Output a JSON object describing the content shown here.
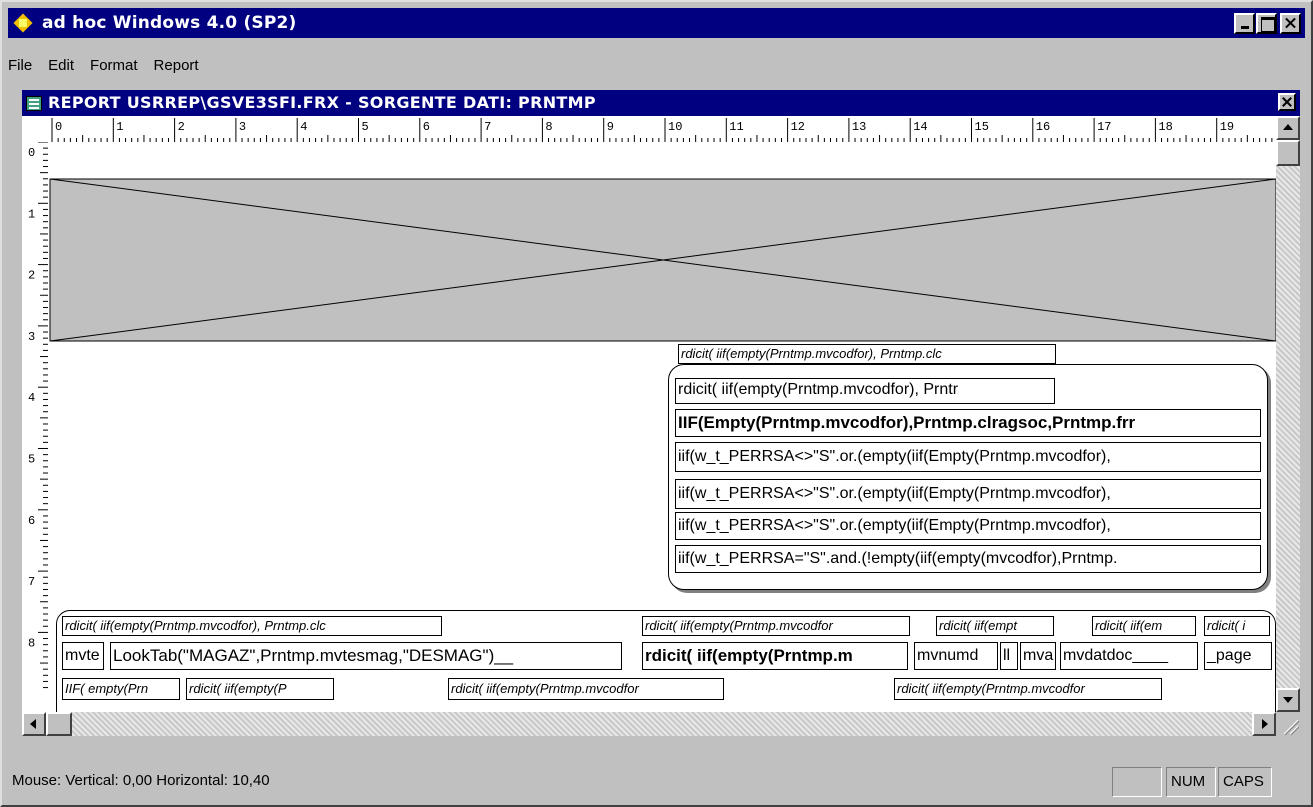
{
  "app": {
    "title": "ad hoc Windows 4.0 (SP2)"
  },
  "menu": [
    {
      "label": "File"
    },
    {
      "label": "Edit"
    },
    {
      "label": "Format"
    },
    {
      "label": "Report"
    }
  ],
  "child": {
    "title": "REPORT USRREP\\GSVE3SFI.FRX - SORGENTE DATI: PRNTMP"
  },
  "ruler": {
    "horizontal": [
      "0",
      "1",
      "2",
      "3",
      "4",
      "5",
      "6",
      "7",
      "8",
      "9",
      "10",
      "11",
      "12",
      "13",
      "14",
      "15",
      "16",
      "17",
      "18",
      "19"
    ],
    "vertical": [
      "0",
      "1",
      "2",
      "3",
      "4",
      "5",
      "6",
      "7",
      "8"
    ]
  },
  "fields": {
    "header_caption": "rdicit( iif(empty(Prntmp.mvcodfor), Prntmp.clc",
    "box1": "rdicit( iif(empty(Prntmp.mvcodfor), Prntr",
    "box2": "IIF(Empty(Prntmp.mvcodfor),Prntmp.clragsoc,Prntmp.frr",
    "box3": "iif(w_t_PERRSA<>\"S\".or.(empty(iif(Empty(Prntmp.mvcodfor),",
    "box4": "iif(w_t_PERRSA<>\"S\".or.(empty(iif(Empty(Prntmp.mvcodfor),",
    "box5": "iif(w_t_PERRSA<>\"S\".or.(empty(iif(Empty(Prntmp.mvcodfor),",
    "box6": "iif(w_t_PERRSA=\"S\".and.(!empty(iif(empty(mvcodfor),Prntmp.",
    "row1_a": "rdicit( iif(empty(Prntmp.mvcodfor), Prntmp.clc",
    "row1_b": "rdicit( iif(empty(Prntmp.mvcodfor",
    "row1_c": "rdicit( iif(empt",
    "row1_d": "rdicit( iif(em",
    "row1_e": "rdicit( i",
    "row2_a": "mvte",
    "row2_b": "LookTab(\"MAGAZ\",Prntmp.mvtesmag,\"DESMAG\")__",
    "row2_c": "rdicit( iif(empty(Prntmp.m",
    "row2_d": "mvnumd",
    "row2_e": "ll",
    "row2_f": "mva",
    "row2_g": "mvdatdoc____",
    "row2_h": "_page",
    "row3_a": "IIF( empty(Prn",
    "row3_b": "rdicit( iif(empty(P",
    "row3_c": "rdicit( iif(empty(Prntmp.mvcodfor",
    "row3_d": "rdicit( iif(empty(Prntmp.mvcodfor"
  },
  "status": {
    "mouse": "Mouse:  Vertical:  0,00   Horizontal: 10,40",
    "num": "NUM",
    "caps": "CAPS"
  }
}
